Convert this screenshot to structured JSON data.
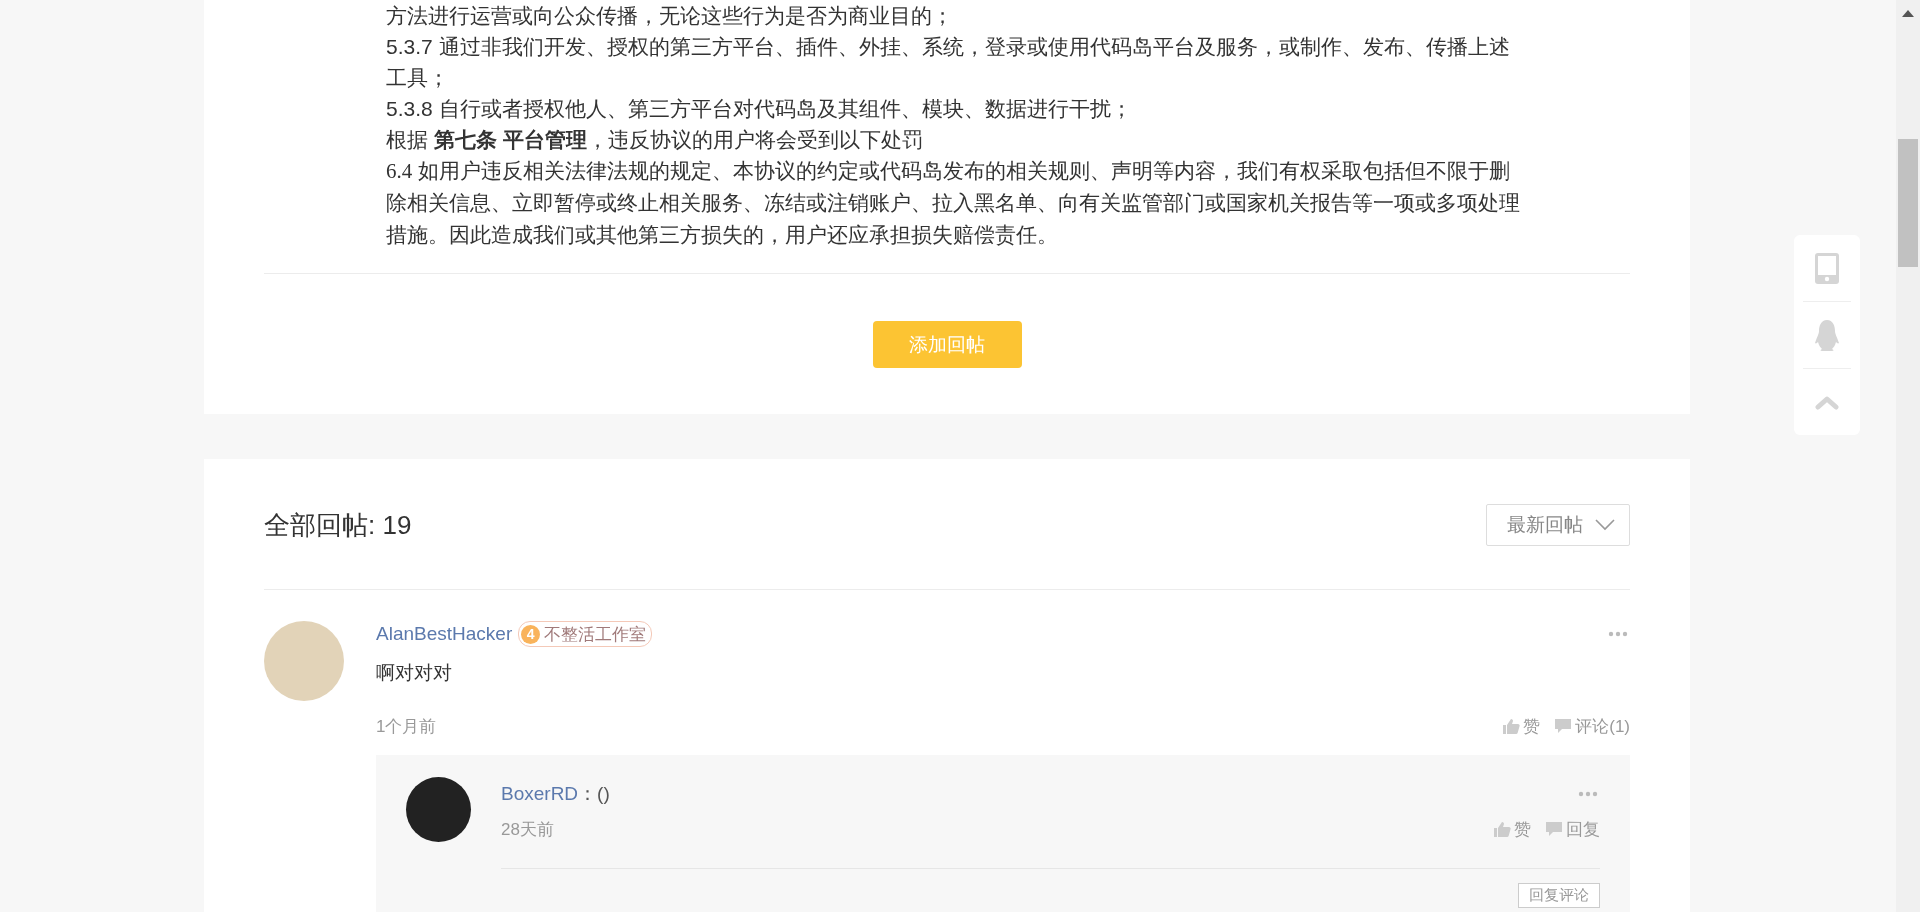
{
  "post": {
    "paragraphs": [
      {
        "kind": "plain",
        "text": "方法进行运营或向公众传播，无论这些行为是否为商业目的；"
      },
      {
        "kind": "plain",
        "text": "5.3.7 通过非我们开发、授权的第三方平台、插件、外挂、系统，登录或使用代码岛平台及服务，或制作、发布、传播上述工具；"
      },
      {
        "kind": "plain",
        "text": "5.3.8 自行或者授权他人、第三方平台对代码岛及其组件、模块、数据进行干扰；"
      },
      {
        "kind": "plain",
        "text": "根据 **第七条 平台管理**，违反协议的用户将会受到以下处罚"
      },
      {
        "kind": "serif",
        "text": "6.4 如用户违反相关法律法规的规定、本协议的约定或代码岛发布的相关规则、声明等内容，我们有权采取包括但不限于删除相关信息、立即暂停或终止相关服务、冻结或注销账户、拉入黑名单、向有关监管部门或国家机关报告等一项或多项处理措施。因此造成我们或其他第三方损失的，用户还应承担损失赔偿责任。"
      }
    ],
    "add_reply_button": "添加回帖"
  },
  "replies": {
    "title": "全部回帖: 19",
    "sort": "最新回帖",
    "comments": [
      {
        "author": "AlanBestHacker",
        "badge_level": "4",
        "badge_text": "不整活工作室",
        "content": "啊对对对",
        "time": "1个月前",
        "like": "赞",
        "comment": "评论(1)",
        "sub_replies": [
          {
            "author": "BoxerRD",
            "content": "：()",
            "time": "28天前",
            "like": "赞",
            "reply": "回复"
          }
        ],
        "reply_button": "回复评论"
      }
    ]
  }
}
